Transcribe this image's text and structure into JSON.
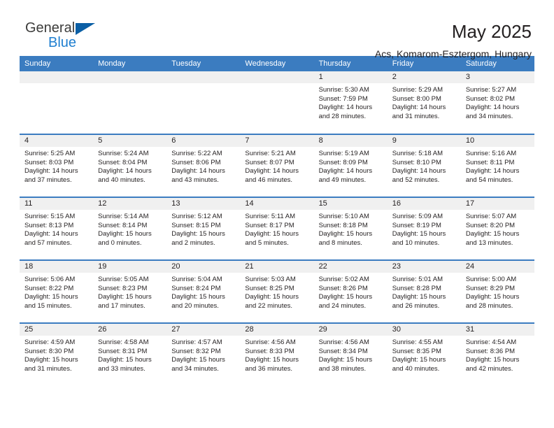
{
  "brand": {
    "name_part1": "General",
    "name_part2": "Blue",
    "triangle_icon": "triangle-icon",
    "color_dark": "#3c3c3b",
    "color_blue": "#1f7fd0",
    "triangle_color": "#0b5fa5"
  },
  "header": {
    "title": "May 2025",
    "subtitle": "Acs, Komarom-Esztergom, Hungary"
  },
  "calendar": {
    "accent_color": "#3b7cc0",
    "band_color": "#f0f0f0",
    "weekdays": [
      "Sunday",
      "Monday",
      "Tuesday",
      "Wednesday",
      "Thursday",
      "Friday",
      "Saturday"
    ],
    "weeks": [
      [
        {
          "day": "",
          "sunrise": "",
          "sunset": "",
          "daylight": "",
          "empty": true
        },
        {
          "day": "",
          "sunrise": "",
          "sunset": "",
          "daylight": "",
          "empty": true
        },
        {
          "day": "",
          "sunrise": "",
          "sunset": "",
          "daylight": "",
          "empty": true
        },
        {
          "day": "",
          "sunrise": "",
          "sunset": "",
          "daylight": "",
          "empty": true
        },
        {
          "day": "1",
          "sunrise": "Sunrise: 5:30 AM",
          "sunset": "Sunset: 7:59 PM",
          "daylight": "Daylight: 14 hours and 28 minutes."
        },
        {
          "day": "2",
          "sunrise": "Sunrise: 5:29 AM",
          "sunset": "Sunset: 8:00 PM",
          "daylight": "Daylight: 14 hours and 31 minutes."
        },
        {
          "day": "3",
          "sunrise": "Sunrise: 5:27 AM",
          "sunset": "Sunset: 8:02 PM",
          "daylight": "Daylight: 14 hours and 34 minutes."
        }
      ],
      [
        {
          "day": "4",
          "sunrise": "Sunrise: 5:25 AM",
          "sunset": "Sunset: 8:03 PM",
          "daylight": "Daylight: 14 hours and 37 minutes."
        },
        {
          "day": "5",
          "sunrise": "Sunrise: 5:24 AM",
          "sunset": "Sunset: 8:04 PM",
          "daylight": "Daylight: 14 hours and 40 minutes."
        },
        {
          "day": "6",
          "sunrise": "Sunrise: 5:22 AM",
          "sunset": "Sunset: 8:06 PM",
          "daylight": "Daylight: 14 hours and 43 minutes."
        },
        {
          "day": "7",
          "sunrise": "Sunrise: 5:21 AM",
          "sunset": "Sunset: 8:07 PM",
          "daylight": "Daylight: 14 hours and 46 minutes."
        },
        {
          "day": "8",
          "sunrise": "Sunrise: 5:19 AM",
          "sunset": "Sunset: 8:09 PM",
          "daylight": "Daylight: 14 hours and 49 minutes."
        },
        {
          "day": "9",
          "sunrise": "Sunrise: 5:18 AM",
          "sunset": "Sunset: 8:10 PM",
          "daylight": "Daylight: 14 hours and 52 minutes."
        },
        {
          "day": "10",
          "sunrise": "Sunrise: 5:16 AM",
          "sunset": "Sunset: 8:11 PM",
          "daylight": "Daylight: 14 hours and 54 minutes."
        }
      ],
      [
        {
          "day": "11",
          "sunrise": "Sunrise: 5:15 AM",
          "sunset": "Sunset: 8:13 PM",
          "daylight": "Daylight: 14 hours and 57 minutes."
        },
        {
          "day": "12",
          "sunrise": "Sunrise: 5:14 AM",
          "sunset": "Sunset: 8:14 PM",
          "daylight": "Daylight: 15 hours and 0 minutes."
        },
        {
          "day": "13",
          "sunrise": "Sunrise: 5:12 AM",
          "sunset": "Sunset: 8:15 PM",
          "daylight": "Daylight: 15 hours and 2 minutes."
        },
        {
          "day": "14",
          "sunrise": "Sunrise: 5:11 AM",
          "sunset": "Sunset: 8:17 PM",
          "daylight": "Daylight: 15 hours and 5 minutes."
        },
        {
          "day": "15",
          "sunrise": "Sunrise: 5:10 AM",
          "sunset": "Sunset: 8:18 PM",
          "daylight": "Daylight: 15 hours and 8 minutes."
        },
        {
          "day": "16",
          "sunrise": "Sunrise: 5:09 AM",
          "sunset": "Sunset: 8:19 PM",
          "daylight": "Daylight: 15 hours and 10 minutes."
        },
        {
          "day": "17",
          "sunrise": "Sunrise: 5:07 AM",
          "sunset": "Sunset: 8:20 PM",
          "daylight": "Daylight: 15 hours and 13 minutes."
        }
      ],
      [
        {
          "day": "18",
          "sunrise": "Sunrise: 5:06 AM",
          "sunset": "Sunset: 8:22 PM",
          "daylight": "Daylight: 15 hours and 15 minutes."
        },
        {
          "day": "19",
          "sunrise": "Sunrise: 5:05 AM",
          "sunset": "Sunset: 8:23 PM",
          "daylight": "Daylight: 15 hours and 17 minutes."
        },
        {
          "day": "20",
          "sunrise": "Sunrise: 5:04 AM",
          "sunset": "Sunset: 8:24 PM",
          "daylight": "Daylight: 15 hours and 20 minutes."
        },
        {
          "day": "21",
          "sunrise": "Sunrise: 5:03 AM",
          "sunset": "Sunset: 8:25 PM",
          "daylight": "Daylight: 15 hours and 22 minutes."
        },
        {
          "day": "22",
          "sunrise": "Sunrise: 5:02 AM",
          "sunset": "Sunset: 8:26 PM",
          "daylight": "Daylight: 15 hours and 24 minutes."
        },
        {
          "day": "23",
          "sunrise": "Sunrise: 5:01 AM",
          "sunset": "Sunset: 8:28 PM",
          "daylight": "Daylight: 15 hours and 26 minutes."
        },
        {
          "day": "24",
          "sunrise": "Sunrise: 5:00 AM",
          "sunset": "Sunset: 8:29 PM",
          "daylight": "Daylight: 15 hours and 28 minutes."
        }
      ],
      [
        {
          "day": "25",
          "sunrise": "Sunrise: 4:59 AM",
          "sunset": "Sunset: 8:30 PM",
          "daylight": "Daylight: 15 hours and 31 minutes."
        },
        {
          "day": "26",
          "sunrise": "Sunrise: 4:58 AM",
          "sunset": "Sunset: 8:31 PM",
          "daylight": "Daylight: 15 hours and 33 minutes."
        },
        {
          "day": "27",
          "sunrise": "Sunrise: 4:57 AM",
          "sunset": "Sunset: 8:32 PM",
          "daylight": "Daylight: 15 hours and 34 minutes."
        },
        {
          "day": "28",
          "sunrise": "Sunrise: 4:56 AM",
          "sunset": "Sunset: 8:33 PM",
          "daylight": "Daylight: 15 hours and 36 minutes."
        },
        {
          "day": "29",
          "sunrise": "Sunrise: 4:56 AM",
          "sunset": "Sunset: 8:34 PM",
          "daylight": "Daylight: 15 hours and 38 minutes."
        },
        {
          "day": "30",
          "sunrise": "Sunrise: 4:55 AM",
          "sunset": "Sunset: 8:35 PM",
          "daylight": "Daylight: 15 hours and 40 minutes."
        },
        {
          "day": "31",
          "sunrise": "Sunrise: 4:54 AM",
          "sunset": "Sunset: 8:36 PM",
          "daylight": "Daylight: 15 hours and 42 minutes."
        }
      ]
    ]
  }
}
